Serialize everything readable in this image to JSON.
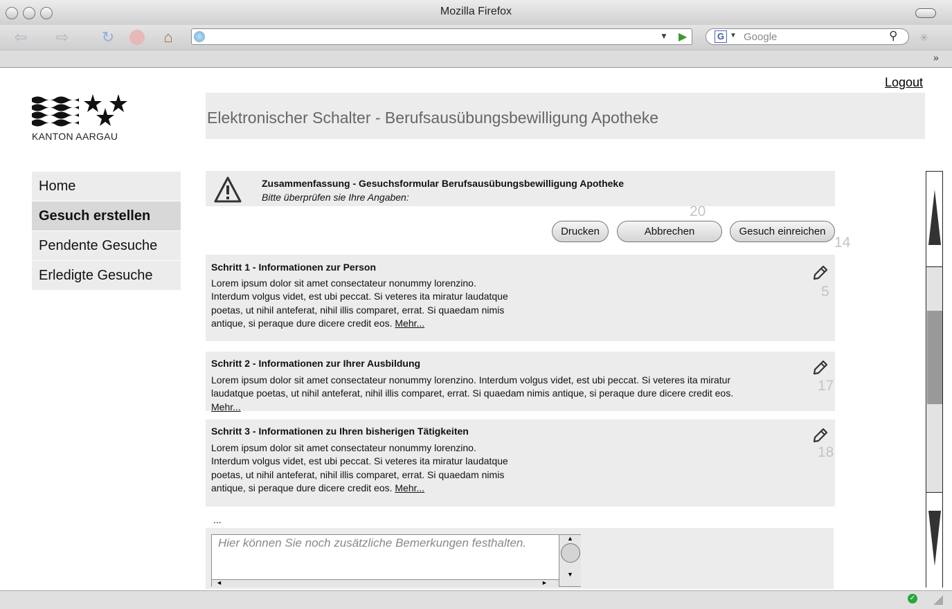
{
  "browser": {
    "window_title": "Mozilla Firefox",
    "search_placeholder": "Google"
  },
  "header": {
    "logout_label": "Logout",
    "page_title": "Elektronischer Schalter - Berufsausübungsbewilligung Apotheke",
    "logo_text": "KANTON AARGAU"
  },
  "sidebar": {
    "items": [
      {
        "label": "Home",
        "active": false
      },
      {
        "label": "Gesuch erstellen",
        "active": true
      },
      {
        "label": "Pendente Gesuche",
        "active": false
      },
      {
        "label": "Erledigte Gesuche",
        "active": false
      }
    ]
  },
  "alert": {
    "title": "Zusammenfassung - Gesuchsformular Berufsausübungsbewilligung Apotheke",
    "subtitle": "Bitte überprüfen sie Ihre Angaben:"
  },
  "actions": {
    "print_label": "Drucken",
    "cancel_label": "Abbrechen",
    "submit_label": "Gesuch einreichen",
    "badge_cancel": "20",
    "badge_submit": "14"
  },
  "steps": [
    {
      "title": "Schritt 1 - Informationen zur Person",
      "lines": [
        "Lorem ipsum dolor sit amet consectateur nonummy lorenzino.",
        "Interdum volgus videt, est ubi peccat. Si veteres ita miratur laudatque",
        "poetas, ut nihil anteferat, nihil illis comparet, errat. Si quaedam nimis",
        "antique, si peraque dure dicere credit eos. "
      ],
      "more": "Mehr...",
      "badge": "5"
    },
    {
      "title": "Schritt 2 - Informationen zur Ihrer Ausbildung",
      "lines": [
        "Lorem ipsum dolor sit amet consectateur nonummy lorenzino. Interdum volgus videt, est ubi peccat. Si veteres ita miratur",
        "laudatque poetas, ut nihil anteferat, nihil illis comparet, errat. Si quaedam nimis antique, si peraque dure dicere credit eos."
      ],
      "more": "Mehr...",
      "badge": "17"
    },
    {
      "title": "Schritt 3 - Informationen zu Ihren bisherigen Tätigkeiten",
      "lines": [
        "Lorem ipsum dolor sit amet consectateur nonummy lorenzino.",
        "Interdum volgus videt, est ubi peccat. Si veteres ita miratur laudatque",
        "poetas, ut nihil anteferat, nihil illis comparet, errat. Si quaedam nimis",
        "antique, si peraque dure dicere credit eos. "
      ],
      "more": "Mehr...",
      "badge": "18"
    }
  ],
  "ellipsis": "...",
  "comment": {
    "placeholder": "Hier können Sie noch zusätzliche Bemerkungen festhalten."
  },
  "icons": {
    "warning": "warning-icon",
    "edit": "pencil-icon"
  }
}
